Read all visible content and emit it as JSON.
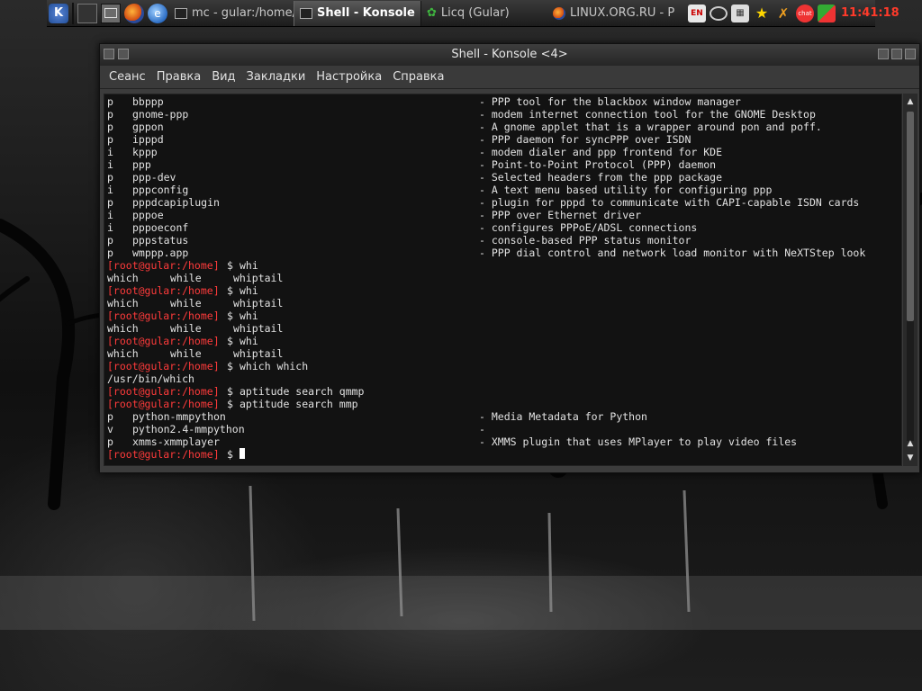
{
  "panel": {
    "kmenu_icon": "kde-k-menu-icon",
    "tasks": [
      {
        "label": "mc - gular:/home/",
        "icon": "terminal-window-icon"
      },
      {
        "label": "Shell - Konsole",
        "icon": "konsole-icon"
      },
      {
        "label": "Licq (Gular)",
        "icon": "licq-flower-icon"
      },
      {
        "label": "LINUX.ORG.RU - P",
        "icon": "firefox-icon"
      }
    ],
    "tray": {
      "kbd_label": "EN",
      "time": "11:41:18",
      "clock_color": "#ff3a2a"
    }
  },
  "window": {
    "title": "Shell - Konsole <4>",
    "menu": [
      "Сеанс",
      "Правка",
      "Вид",
      "Закладки",
      "Настройка",
      "Справка"
    ]
  },
  "terminal": {
    "prompt_color": "#ff3b3b",
    "packages_top": [
      {
        "state": "p",
        "name": "bbppp",
        "desc": "- PPP tool for the blackbox window manager"
      },
      {
        "state": "p",
        "name": "gnome-ppp",
        "desc": "- modem internet connection tool for the GNOME Desktop"
      },
      {
        "state": "p",
        "name": "gppon",
        "desc": "- A gnome applet that is a wrapper around pon and poff."
      },
      {
        "state": "p",
        "name": "ipppd",
        "desc": "- PPP daemon for syncPPP over ISDN"
      },
      {
        "state": "i",
        "name": "kppp",
        "desc": "- modem dialer and ppp frontend for KDE"
      },
      {
        "state": "i",
        "name": "ppp",
        "desc": "- Point-to-Point Protocol (PPP) daemon"
      },
      {
        "state": "p",
        "name": "ppp-dev",
        "desc": "- Selected headers from the ppp package"
      },
      {
        "state": "i",
        "name": "pppconfig",
        "desc": "- A text menu based utility for configuring ppp"
      },
      {
        "state": "p",
        "name": "pppdcapiplugin",
        "desc": "- plugin for pppd to communicate with CAPI-capable ISDN cards"
      },
      {
        "state": "i",
        "name": "pppoe",
        "desc": "- PPP over Ethernet driver"
      },
      {
        "state": "i",
        "name": "pppoeconf",
        "desc": "- configures PPPoE/ADSL connections"
      },
      {
        "state": "p",
        "name": "pppstatus",
        "desc": "- console-based PPP status monitor"
      },
      {
        "state": "p",
        "name": "wmppp.app",
        "desc": "- PPP dial control and network load monitor with NeXTStep look"
      }
    ],
    "prompt": "[root@gular:/home]",
    "dollar": "$",
    "cmd_whi": "whi",
    "completions": [
      "which",
      "while",
      "whiptail"
    ],
    "cmd_which": "which which",
    "which_result": "/usr/bin/which",
    "cmd_search_qmmp": "aptitude search qmmp",
    "cmd_search_mmp": "aptitude search mmp",
    "packages_mmp": [
      {
        "state": "p",
        "name": "python-mmpython",
        "desc": "- Media Metadata for Python"
      },
      {
        "state": "v",
        "name": "python2.4-mmpython",
        "desc": "-"
      },
      {
        "state": "p",
        "name": "xmms-xmmplayer",
        "desc": "- XMMS plugin that uses MPlayer to play video files"
      }
    ]
  }
}
